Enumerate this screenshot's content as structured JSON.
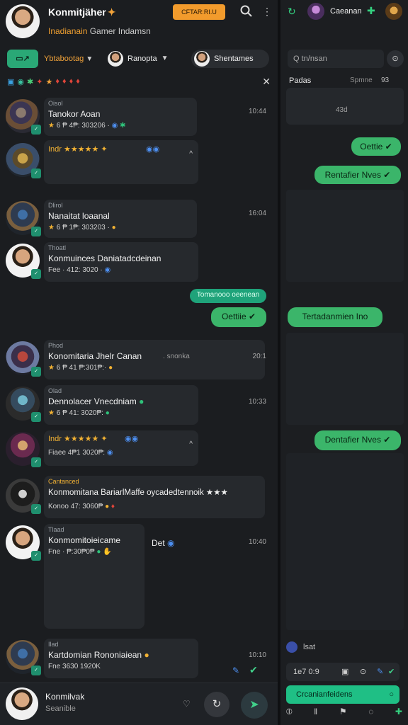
{
  "header": {
    "title": "Konmitjäher",
    "subtitle_prefix": "Inadianain",
    "subtitle_rest": " Gamer Indamsn",
    "promo_label": "CFTAR:RI.U"
  },
  "filters": {
    "chip_a": "Ybtabootag",
    "chip_b": "Ranopta",
    "chip_c": "Shentames"
  },
  "chats": [
    {
      "tag": "Oisol",
      "name": "Tanokor Aoan",
      "meta": "6 ₱ 4₱: 303206 ·",
      "time": "10:44"
    },
    {
      "tag": "",
      "name": "Indr ★★★★★ ✦",
      "meta": "",
      "time": ""
    },
    {
      "tag": "Dlirol",
      "name": "Nanaitat loaanal",
      "meta": "6 ₱ 1₱: 303203 ·",
      "time": "16:04"
    },
    {
      "tag": "Thoatl",
      "name": "Konmuinces Daniatadcdeinan",
      "meta": "Fee · 412: 3020 ·",
      "time": ""
    },
    {
      "tag": "Phod",
      "name": "Konomitaria Jhelr Canan",
      "name_extra": ". snonka",
      "meta": "6 ₱ 41 ₱:301₱:·",
      "time": "20:1"
    },
    {
      "tag": "Olad",
      "name": "Dennolacer Vnecdniam",
      "meta": "6 ₱ 41: 3020₱:",
      "time": "10:33"
    },
    {
      "tag": "",
      "name": "Indr ★★★★★ ✦",
      "meta": "Fiaee 4₱1 3020₱:",
      "time": ""
    },
    {
      "tag": "Cantanced",
      "name": "Konmomitana BariarlMaffe oycadedtennoik ★★★",
      "meta": "Konoo 47: 3060₱",
      "time": ""
    },
    {
      "tag": "Tlaad",
      "name": "Konmomitoieicame",
      "name_extra": "Det",
      "meta": "Fne · ₱:30₱0₱",
      "time": "10:40"
    },
    {
      "tag": "Ilad",
      "name": "Kartdomian Rononiaiean",
      "meta": "Fne 3630 1920K",
      "time": "10:10"
    }
  ],
  "sent_messages": {
    "small": "Tomanooo oeenean",
    "status": "Oettiie ✔"
  },
  "composer": {
    "name": "Konmilvak",
    "sub": "Seanible"
  },
  "right": {
    "name": "Caeanan",
    "search_placeholder": "Q  tn/nsan",
    "label1": "Padas",
    "label2": "Spmne",
    "label3": "93",
    "card_value": "43d",
    "bubble1": "Oettie ✔",
    "bubble2": "Rentafier Nves ✔",
    "bubble3": "Tertadanmien Ino",
    "bubble4": "Dentafier Nves ✔",
    "foot": "lsat",
    "input_value": "1e7 0:9",
    "cta": "Crcanianfeidens"
  },
  "colors": {
    "accent_green": "#3bb56a",
    "accent_orange": "#f29b2c",
    "bg": "#1b1d20"
  }
}
